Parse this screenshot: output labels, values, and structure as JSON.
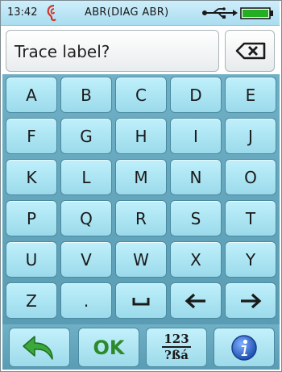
{
  "status": {
    "time": "13:42",
    "title": "ABR(DIAG ABR)",
    "icons": [
      "ear-icon",
      "usb-icon",
      "battery-icon"
    ]
  },
  "input": {
    "placeholder": "Trace label?",
    "value": ""
  },
  "keys": {
    "row1": [
      "A",
      "B",
      "C",
      "D",
      "E"
    ],
    "row2": [
      "F",
      "G",
      "H",
      "I",
      "J"
    ],
    "row3": [
      "K",
      "L",
      "M",
      "N",
      "O"
    ],
    "row4": [
      "P",
      "Q",
      "R",
      "S",
      "T"
    ],
    "row5": [
      "U",
      "V",
      "W",
      "X",
      "Y"
    ],
    "row6": [
      "Z",
      "."
    ],
    "special": [
      "space-icon",
      "arrow-left-icon",
      "arrow-right-icon",
      "backspace-icon"
    ]
  },
  "bottom": {
    "ok_label": "OK",
    "mode_top": "123",
    "mode_bottom": "?ßá",
    "icons": [
      "back-arrow-icon",
      "info-icon"
    ]
  },
  "colors": {
    "key_fill": "#9bdaeb",
    "keyboard_bg": "#5a9cb3",
    "ok_green": "#2d8a2a",
    "ear_red": "#d0352b",
    "info_blue": "#2a63c8",
    "battery_green": "#22b022"
  }
}
